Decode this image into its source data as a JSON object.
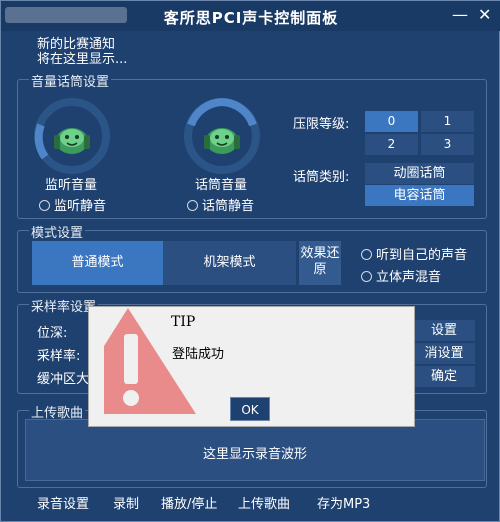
{
  "window": {
    "title": "客所思PCI声卡控制面板",
    "minimize": "—",
    "close": "✕"
  },
  "notice": {
    "line1": "新的比赛通知",
    "line2": "将在这里显示..."
  },
  "volume_group": {
    "title": "音量话筒设置",
    "monitor_label": "监听音量",
    "monitor_mute": "监听静音",
    "mic_label": "话筒音量",
    "mic_mute": "话筒静音",
    "limit_label": "压限等级:",
    "limit_levels": [
      "0",
      "1",
      "2",
      "3"
    ],
    "limit_selected": "0",
    "mic_type_label": "话筒类别:",
    "mic_type_dynamic": "动圈话筒",
    "mic_type_condenser": "电容话筒",
    "mic_type_selected": "电容话筒"
  },
  "mode_group": {
    "title": "模式设置",
    "normal": "普通模式",
    "rack": "机架模式",
    "restore": "效果还原",
    "hear_self": "听到自己的声音",
    "stereo_mix": "立体声混音",
    "selected": "普通模式"
  },
  "sample_group": {
    "title": "采样率设置",
    "bit_depth": "位深:",
    "sample_rate": "采样率:",
    "buffer": "缓冲区大",
    "set_btn": "设置",
    "cancel_btn": "消设置",
    "confirm_btn": "确定"
  },
  "upload_group": {
    "title": "上传歌曲",
    "wave_placeholder": "这里显示录音波形"
  },
  "bottom_bar": {
    "record_settings": "录音设置",
    "record": "录制",
    "play_stop": "播放/停止",
    "upload": "上传歌曲",
    "save_mp3": "存为MP3"
  },
  "dialog": {
    "title": "TIP",
    "message": "登陆成功",
    "ok": "OK"
  },
  "colors": {
    "window_bg": "#1f4170",
    "accent": "#3b76c0",
    "warning_red": "#e98b8b"
  },
  "icons": {
    "monitor_knob": "headset-knob-icon",
    "mic_knob": "headset-knob-icon",
    "warning": "warning-triangle-icon"
  }
}
